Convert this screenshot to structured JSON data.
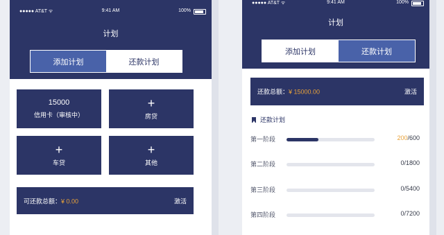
{
  "screen_left": {
    "status": {
      "carrier": "●●●●● AT&T ᯤ",
      "time": "9:41 AM",
      "battery": "100%"
    },
    "title": "计划",
    "tabs": [
      {
        "label": "添加计划",
        "active": true
      },
      {
        "label": "还款计划",
        "active": false
      }
    ],
    "tiles": [
      {
        "kind": "value",
        "value": "15000",
        "label": "信用卡（审核中）"
      },
      {
        "kind": "add",
        "plus": "+",
        "label": "房贷"
      },
      {
        "kind": "add",
        "plus": "+",
        "label": "车贷"
      },
      {
        "kind": "add",
        "plus": "+",
        "label": "其他"
      }
    ],
    "total": {
      "label": "可还款总额：",
      "amount": "¥ 0.00",
      "action": "激活"
    }
  },
  "screen_right": {
    "status": {
      "carrier": "●●●●● AT&T ᯤ",
      "time": "9:41 AM",
      "battery": "100%"
    },
    "title": "计划",
    "tabs": [
      {
        "label": "添加计划",
        "active": false
      },
      {
        "label": "还款计划",
        "active": true
      }
    ],
    "total": {
      "label": "还款总额：",
      "amount": "¥ 15000.00",
      "action": "激活"
    },
    "section_title": "还款计划",
    "stages": [
      {
        "label": "第一阶段",
        "paid": "200",
        "total": "/600",
        "progress": 0.36
      },
      {
        "label": "第二阶段",
        "paid": "0",
        "total": "/1800",
        "progress": 0
      },
      {
        "label": "第三阶段",
        "paid": "0",
        "total": "/5400",
        "progress": 0
      },
      {
        "label": "第四阶段",
        "paid": "0",
        "total": "/7200",
        "progress": 0
      }
    ]
  },
  "colors": {
    "primary": "#2c3566",
    "accent": "#4962a9",
    "highlight": "#e8a23a",
    "track": "#e3e5ec"
  }
}
